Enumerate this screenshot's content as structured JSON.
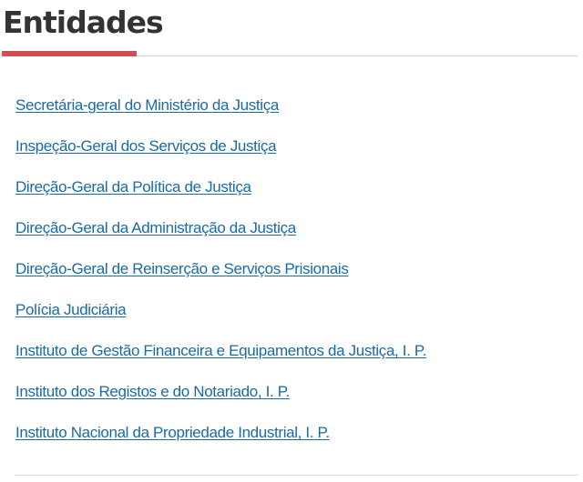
{
  "section": {
    "title": "Entidades"
  },
  "entities": [
    {
      "label": "Secretária-geral do Ministério da Justiça"
    },
    {
      "label": "Inspeção-Geral dos Serviços de Justiça"
    },
    {
      "label": "Direção-Geral da Política de Justiça"
    },
    {
      "label": "Direção-Geral da Administração da Justiça"
    },
    {
      "label": "Direção-Geral de Reinserção e Serviços Prisionais"
    },
    {
      "label": "Polícia Judiciária"
    },
    {
      "label": "Instituto de Gestão Financeira e Equipamentos da Justiça, I. P."
    },
    {
      "label": "Instituto dos Registos e do Notariado, I. P."
    },
    {
      "label": "Instituto Nacional da Propriedade Industrial, I. P."
    }
  ],
  "colors": {
    "title_text": "#333333",
    "accent": "#d14f4f",
    "link": "#1a6aa3",
    "rule": "#d2d2d2"
  }
}
